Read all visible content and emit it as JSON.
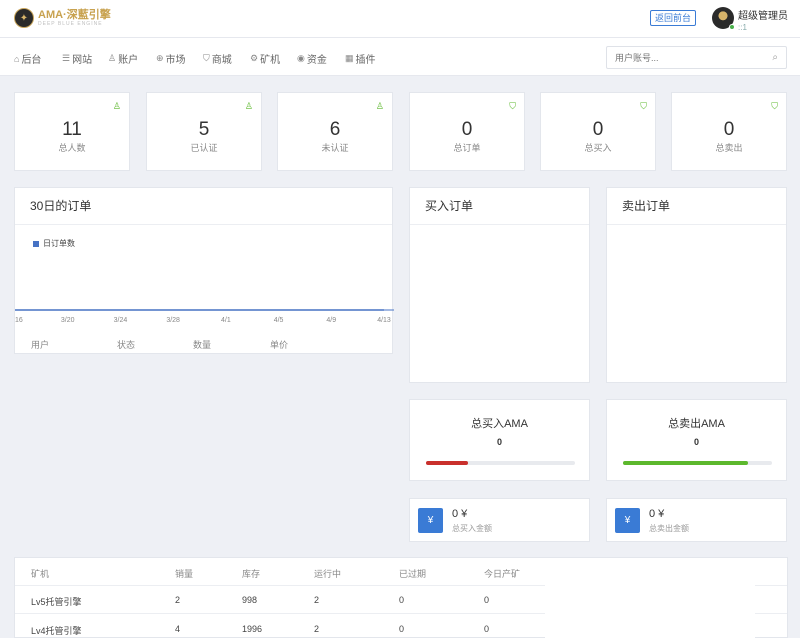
{
  "header": {
    "logo_text": "AMA·深藍引擎",
    "logo_subtext": "DEEP BLUE ENGINE",
    "back_button": "返回前台",
    "user_name": "超级管理员",
    "user_sub": "::1"
  },
  "nav": {
    "items": [
      {
        "label": "后台",
        "icon": "home-icon"
      },
      {
        "label": "网站",
        "icon": "list-icon"
      },
      {
        "label": "账户",
        "icon": "user-icon"
      },
      {
        "label": "市场",
        "icon": "globe-icon"
      },
      {
        "label": "商城",
        "icon": "cart-icon"
      },
      {
        "label": "矿机",
        "icon": "gear-icon"
      },
      {
        "label": "资金",
        "icon": "money-icon"
      },
      {
        "label": "插件",
        "icon": "grid-icon"
      }
    ],
    "search_placeholder": "用户账号..."
  },
  "stats": [
    {
      "value": "11",
      "label": "总人数",
      "icon": "user-icon"
    },
    {
      "value": "5",
      "label": "已认证",
      "icon": "user-icon"
    },
    {
      "value": "6",
      "label": "未认证",
      "icon": "user-icon"
    },
    {
      "value": "0",
      "label": "总订单",
      "icon": "cart-icon"
    },
    {
      "value": "0",
      "label": "总买入",
      "icon": "cart-icon"
    },
    {
      "value": "0",
      "label": "总卖出",
      "icon": "cart-icon"
    }
  ],
  "orders30": {
    "title": "30日的订单",
    "table_headers": [
      "用户",
      "状态",
      "数量",
      "单价"
    ]
  },
  "chart_data": {
    "type": "line",
    "series": [
      {
        "name": "日订单数",
        "values": [
          0,
          0,
          0,
          0,
          0,
          0,
          0,
          0
        ]
      }
    ],
    "x": [
      "16",
      "3/20",
      "3/24",
      "3/28",
      "4/1",
      "4/5",
      "4/9",
      "4/13"
    ],
    "color": "#4672c4"
  },
  "buy_orders": {
    "title": "买入订单"
  },
  "sell_orders": {
    "title": "卖出订单"
  },
  "buy_summary": {
    "title": "总买入AMA",
    "value": "0",
    "progress": 0.28,
    "color": "#c9302c"
  },
  "sell_summary": {
    "title": "总卖出AMA",
    "value": "0",
    "progress": 0.84,
    "color": "#5cb82d"
  },
  "buy_amount": {
    "icon_glyph": "¥",
    "value": "0 ¥",
    "label": "总买入金额"
  },
  "sell_amount": {
    "icon_glyph": "¥",
    "value": "0 ¥",
    "label": "总卖出金额"
  },
  "miner_table": {
    "headers": [
      "矿机",
      "销量",
      "库存",
      "运行中",
      "已过期",
      "今日产矿"
    ],
    "rows": [
      [
        "Lv5托管引擎",
        "2",
        "998",
        "2",
        "0",
        "0"
      ],
      [
        "Lv4托管引擎",
        "4",
        "1996",
        "2",
        "0",
        "0"
      ]
    ]
  }
}
